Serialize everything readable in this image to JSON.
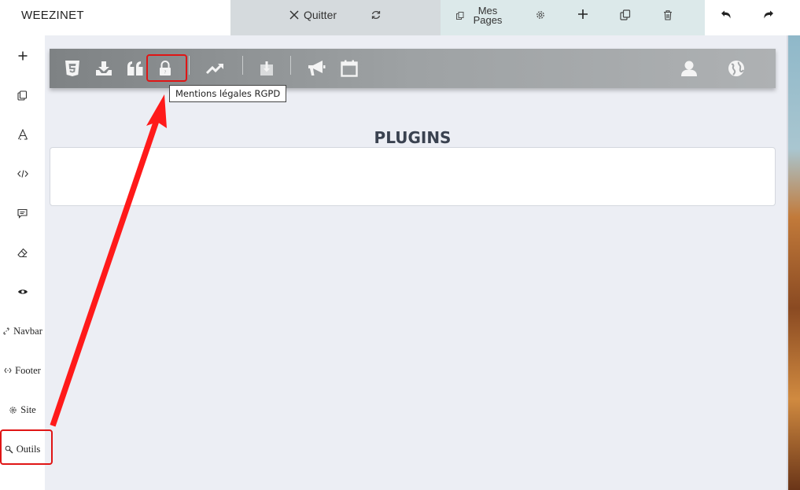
{
  "topbar": {
    "brand": "WEEZINET",
    "quit_label": "Quitter",
    "mes_pages_label": "Mes Pages",
    "colors": {
      "quit_segment": "#d5dadd",
      "pages_segment": "#dce9ea"
    }
  },
  "sidebar": {
    "items": [
      {
        "icon": "plus-icon",
        "label": ""
      },
      {
        "icon": "copy-icon",
        "label": ""
      },
      {
        "icon": "font-icon",
        "label": ""
      },
      {
        "icon": "code-icon",
        "label": ""
      },
      {
        "icon": "comment-icon",
        "label": ""
      },
      {
        "icon": "eraser-icon",
        "label": ""
      },
      {
        "icon": "eye-icon",
        "label": ""
      },
      {
        "icon": "link-icon",
        "label": "Navbar"
      },
      {
        "icon": "footer-icon",
        "label": "Footer"
      },
      {
        "icon": "gear-icon",
        "label": "Site"
      },
      {
        "icon": "tools-icon",
        "label": "Outils"
      }
    ]
  },
  "plugin_toolbar": {
    "icons": [
      "css3-icon",
      "download-icon",
      "quote-icon",
      "lock-icon",
      "trending-icon",
      "import-icon",
      "megaphone-icon",
      "calendar-icon",
      "user-icon",
      "globe-icon"
    ],
    "tooltip": "Mentions légales RGPD"
  },
  "main": {
    "title": "PLUGINS"
  },
  "annotations": {
    "highlight_color": "#e01515"
  }
}
